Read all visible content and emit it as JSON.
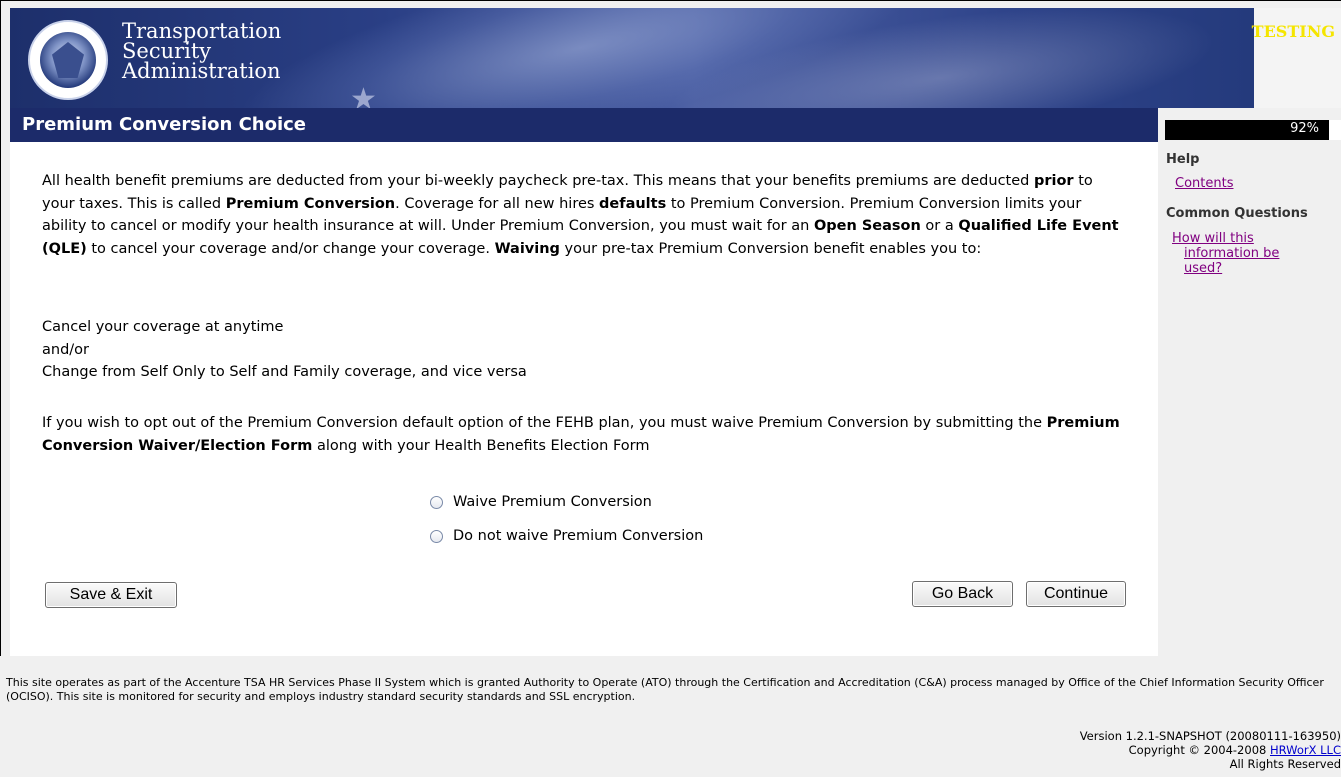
{
  "banner": {
    "agency_line1": "Transportation",
    "agency_line2": "Security",
    "agency_line3": "Administration",
    "environment_badge": "TESTING"
  },
  "header": {
    "title": "Premium Conversion Choice",
    "progress_text": "92%",
    "progress_value": 92
  },
  "main": {
    "p1_a": "All health benefit premiums are deducted from your bi-weekly paycheck pre-tax. This means that your benefits premiums are deducted ",
    "p1_b": "prior",
    "p1_c": " to your taxes. This is called ",
    "p1_d": "Premium Conversion",
    "p1_e": ". Coverage for all new hires ",
    "p1_f": "defaults",
    "p1_g": " to Premium Conversion. Premium Conversion limits your ability to cancel or modify your health insurance at will. Under Premium Conversion, you must wait for an ",
    "p1_h": "Open Season",
    "p1_i": " or a ",
    "p1_j": "Qualified Life Event (QLE)",
    "p1_k": " to cancel your coverage and/or change your coverage. ",
    "p1_l": "Waiving",
    "p1_m": " your pre-tax Premium Conversion benefit enables you to:",
    "opt_line1": "Cancel your coverage at anytime",
    "opt_line2": "and/or",
    "opt_line3": "Change from Self Only to Self and Family coverage, and vice versa",
    "p3_a": "If you wish to opt out of the Premium Conversion default option of the FEHB plan, you must waive Premium Conversion by submitting the ",
    "p3_b": "Premium Conversion Waiver/Election Form",
    "p3_c": " along with your Health Benefits Election Form",
    "radio_waive": "Waive Premium Conversion",
    "radio_not_waive": "Do not waive Premium Conversion"
  },
  "buttons": {
    "save_exit": "Save & Exit",
    "go_back": "Go Back",
    "continue": "Continue"
  },
  "sidebar": {
    "help_heading": "Help",
    "contents_link": "Contents",
    "cq_heading": "Common Questions",
    "q1_line1": "How will this",
    "q1_line2": "information be",
    "q1_line3": "used?"
  },
  "footer": {
    "notice": "This site operates as part of the Accenture TSA HR Services Phase II System which is granted Authority to Operate (ATO) through the Certification and Accreditation (C&A) process managed by Office of the Chief Information Security Officer (OCISO). This site is monitored for security and employs industry standard security standards and SSL encryption.",
    "version": "Version 1.2.1-SNAPSHOT (20080111-163950)",
    "copyright_prefix": "Copyright © 2004-2008 ",
    "copyright_link": "HRWorX LLC",
    "rights": "All Rights Reserved"
  }
}
